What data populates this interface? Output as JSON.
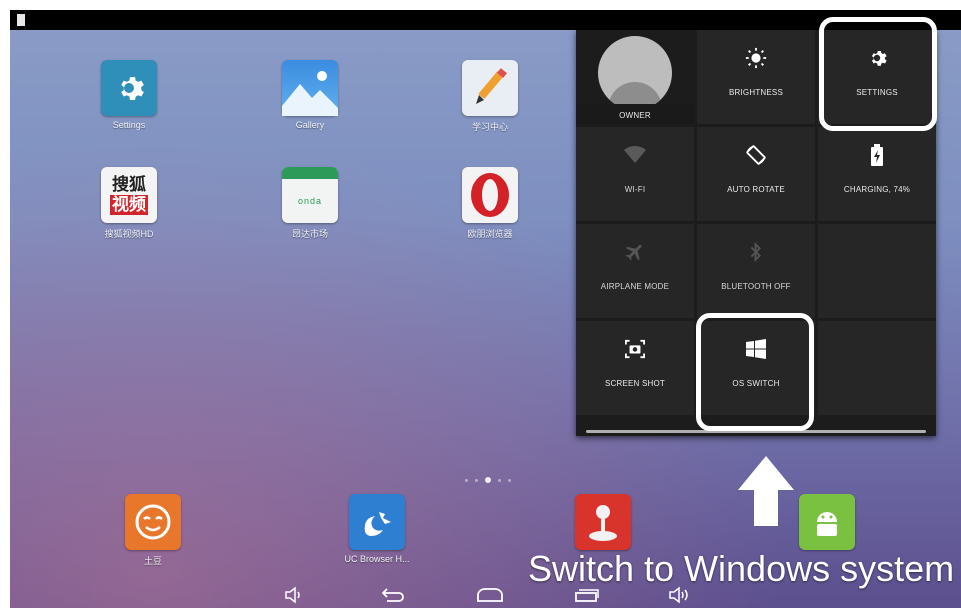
{
  "desktop": {
    "apps": [
      {
        "label": "Settings",
        "icon": "gear-icon"
      },
      {
        "label": "Gallery",
        "icon": "gallery-icon"
      },
      {
        "label": "学习中心",
        "icon": "pencil-icon"
      },
      {
        "label": "搜狐视频HD",
        "icon": "sohu-video-icon",
        "tile_top": "搜狐",
        "tile_bottom": "视频"
      },
      {
        "label": "昂达市场",
        "icon": "onda-market-icon",
        "tile_text": "onda"
      },
      {
        "label": "欧朋浏览器",
        "icon": "opera-icon"
      }
    ],
    "dock": [
      {
        "label": "土豆",
        "icon": "tudou-icon"
      },
      {
        "label": "UC Browser H...",
        "icon": "uc-browser-icon"
      },
      {
        "label": "",
        "icon": "joystick-icon"
      },
      {
        "label": "",
        "icon": "android-icon"
      }
    ]
  },
  "quick_settings": {
    "owner_label": "OWNER",
    "tiles": [
      {
        "label": "BRIGHTNESS",
        "icon": "brightness-icon"
      },
      {
        "label": "SETTINGS",
        "icon": "gear-icon"
      },
      {
        "label": "WI-FI",
        "icon": "wifi-icon"
      },
      {
        "label": "AUTO ROTATE",
        "icon": "rotate-icon"
      },
      {
        "label": "CHARGING, 74%",
        "icon": "battery-charging-icon"
      },
      {
        "label": "AIRPLANE MODE",
        "icon": "airplane-icon"
      },
      {
        "label": "BLUETOOTH OFF",
        "icon": "bluetooth-icon"
      },
      {
        "label": "SCREEN SHOT",
        "icon": "screenshot-icon"
      },
      {
        "label": "OS SWITCH",
        "icon": "windows-icon"
      }
    ],
    "battery_percent": 74
  },
  "caption": "Switch to Windows system",
  "navbar": {
    "buttons": [
      "volume-down-icon",
      "back-icon",
      "home-icon",
      "recents-icon",
      "volume-up-icon"
    ]
  },
  "colors": {
    "highlight": "#ffffff",
    "panel": "#262626"
  }
}
